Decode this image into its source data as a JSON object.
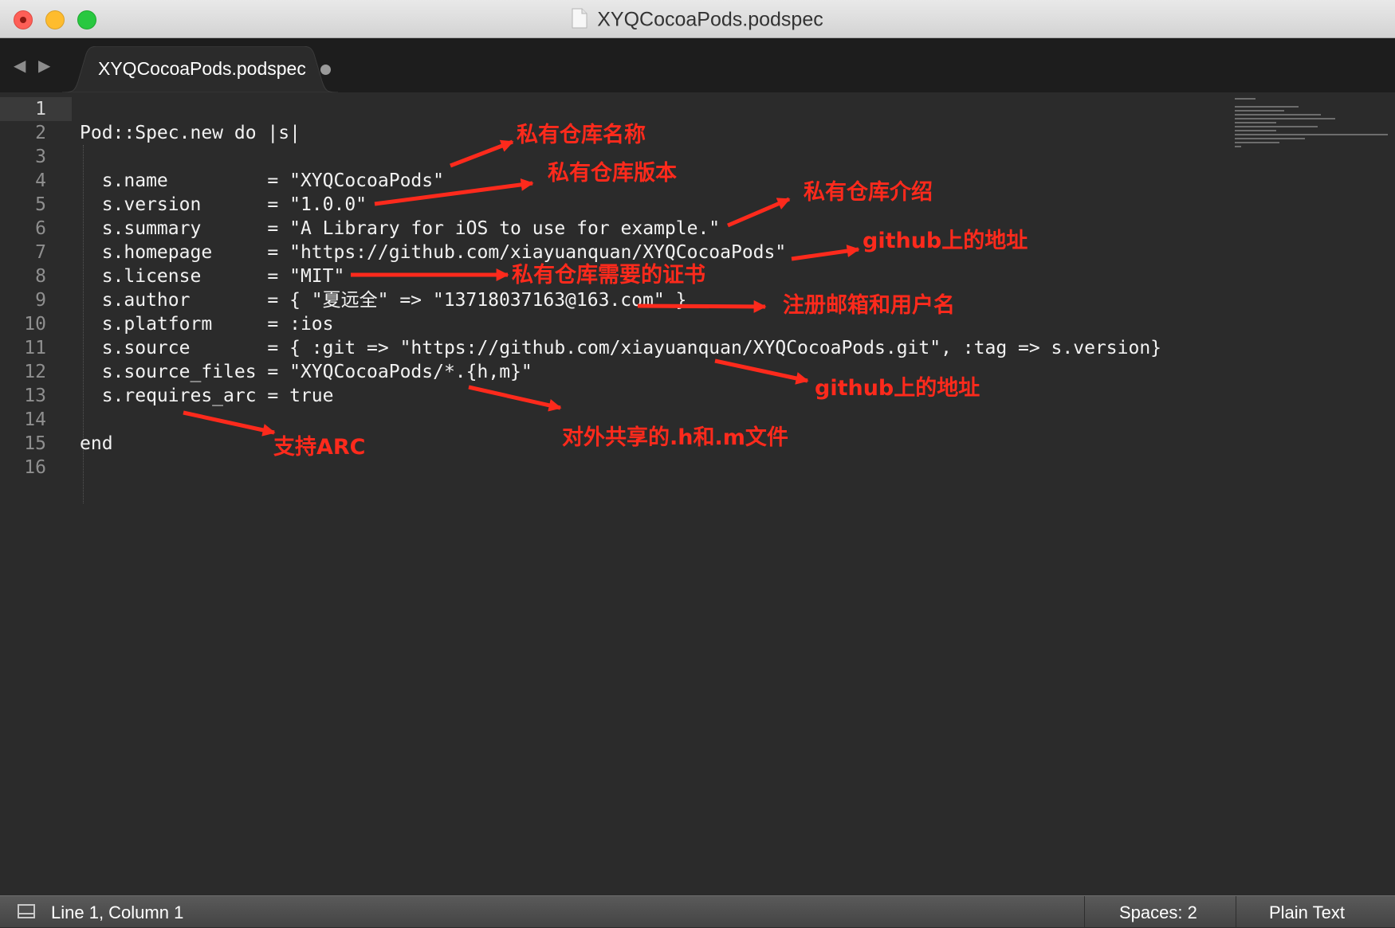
{
  "window": {
    "title": "XYQCocoaPods.podspec",
    "tab_label": "XYQCocoaPods.podspec",
    "tab_modified": true
  },
  "editor": {
    "line_numbers": [
      "1",
      "2",
      "3",
      "4",
      "5",
      "6",
      "7",
      "8",
      "9",
      "10",
      "11",
      "12",
      "13",
      "14",
      "15",
      "16"
    ],
    "active_line": 1,
    "lines": [
      "",
      "Pod::Spec.new do |s|",
      "",
      "  s.name         = \"XYQCocoaPods\"",
      "  s.version      = \"1.0.0\"",
      "  s.summary      = \"A Library for iOS to use for example.\"",
      "  s.homepage     = \"https://github.com/xiayuanquan/XYQCocoaPods\"",
      "  s.license      = \"MIT\"",
      "  s.author       = { \"夏远全\" => \"13718037163@163.com\" }",
      "  s.platform     = :ios",
      "  s.source       = { :git => \"https://github.com/xiayuanquan/XYQCocoaPods.git\", :tag => s.version}",
      "  s.source_files = \"XYQCocoaPods/*.{h,m}\"",
      "  s.requires_arc = true",
      "",
      "end",
      ""
    ]
  },
  "annotations": {
    "color": "#fd2a1c",
    "items": [
      "私有仓库名称",
      "私有仓库版本",
      "私有仓库介绍",
      "github上的地址",
      "私有仓库需要的证书",
      "注册邮箱和用户名",
      "github上的地址",
      "对外共享的.h和.m文件",
      "支持ARC"
    ]
  },
  "statusbar": {
    "position": "Line 1, Column 1",
    "spaces": "Spaces: 2",
    "syntax": "Plain Text"
  }
}
